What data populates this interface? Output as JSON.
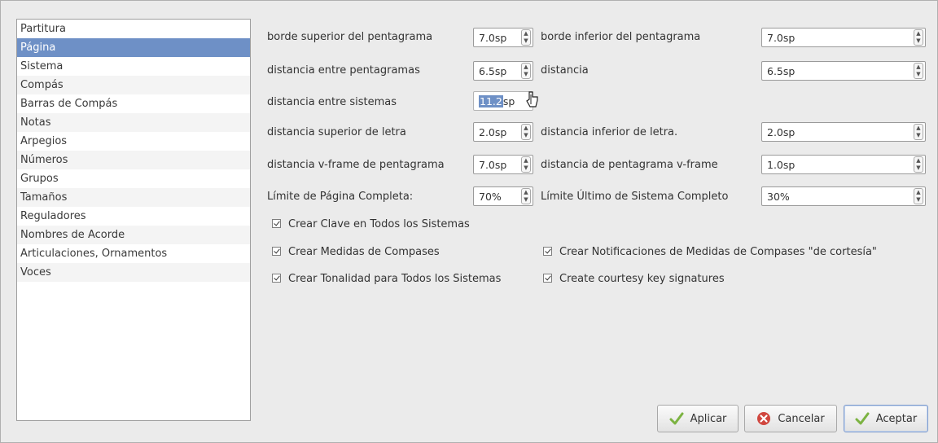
{
  "sidebar": {
    "items": [
      {
        "label": "Partitura"
      },
      {
        "label": "Página"
      },
      {
        "label": "Sistema"
      },
      {
        "label": "Compás"
      },
      {
        "label": "Barras de Compás"
      },
      {
        "label": "Notas"
      },
      {
        "label": "Arpegios"
      },
      {
        "label": "Números"
      },
      {
        "label": "Grupos"
      },
      {
        "label": "Tamaños"
      },
      {
        "label": "Reguladores"
      },
      {
        "label": "Nombres de Acorde"
      },
      {
        "label": "Articulaciones, Ornamentos"
      },
      {
        "label": "Voces"
      }
    ],
    "selected": "Página"
  },
  "form": {
    "staff_upper_border": {
      "label": "borde superior del pentagrama",
      "value": "7.0sp"
    },
    "staff_lower_border": {
      "label": "borde inferior del pentagrama",
      "value": "7.0sp"
    },
    "staff_distance": {
      "label": "distancia entre pentagramas",
      "value": "6.5sp"
    },
    "distance": {
      "label": "distancia",
      "value": "6.5sp"
    },
    "system_distance": {
      "label": "distancia entre sistemas",
      "value_selected": "11.2",
      "value_unit": "sp"
    },
    "lyrics_upper": {
      "label": "distancia superior de letra",
      "value": "2.0sp"
    },
    "lyrics_lower": {
      "label": "distancia inferior de letra.",
      "value": "2.0sp"
    },
    "vframe_staff": {
      "label": "distancia v-frame de pentagrama",
      "value": "7.0sp"
    },
    "staff_vframe": {
      "label": "distancia de pentagrama v-frame",
      "value": "1.0sp"
    },
    "page_fill_limit": {
      "label": "Límite de Página Completa:",
      "value": "70%"
    },
    "last_system_fill": {
      "label": "Límite Último de Sistema Completo",
      "value": "30%"
    }
  },
  "checkboxes": {
    "clef_all_systems": {
      "label": "Crear Clave en Todos los Sistemas",
      "checked": true
    },
    "measure_numbers": {
      "label": "Crear Medidas de Compases",
      "checked": true
    },
    "courtesy_time": {
      "label": "Crear Notificaciones de Medidas de Compases \"de cortesía\"",
      "checked": true
    },
    "key_all_systems": {
      "label": "Crear Tonalidad para Todos los Sistemas",
      "checked": true
    },
    "courtesy_key": {
      "label": "Create courtesy key signatures",
      "checked": true
    }
  },
  "buttons": {
    "apply": "Aplicar",
    "cancel": "Cancelar",
    "accept": "Aceptar"
  },
  "icons": {
    "spin_up": "▲",
    "spin_down": "▼"
  },
  "colors": {
    "selection": "#6e90c6",
    "check_green": "#7cb342",
    "cancel_red": "#d0463e"
  }
}
